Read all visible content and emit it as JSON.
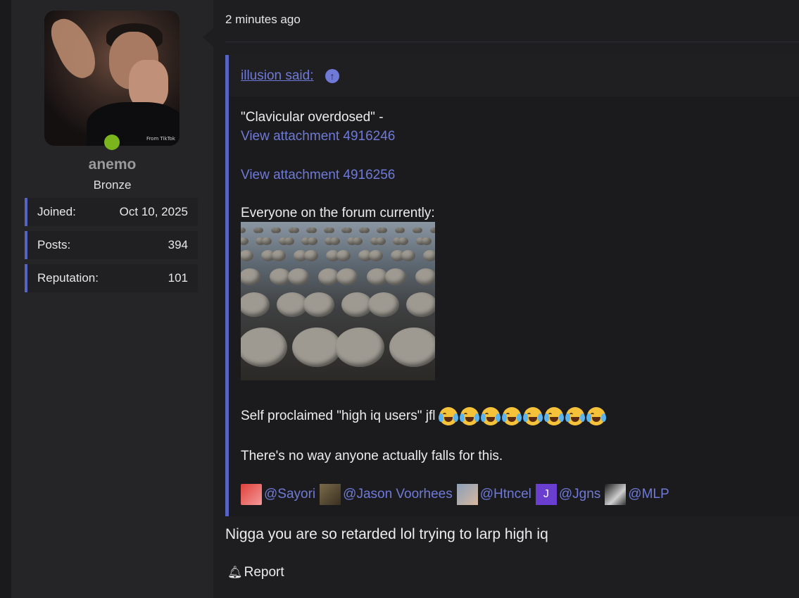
{
  "user": {
    "username": "anemo",
    "rank": "Bronze",
    "online": true,
    "avatar_watermark": "From TikTok",
    "stats": [
      {
        "label": "Joined:",
        "value": "Oct 10, 2025"
      },
      {
        "label": "Posts:",
        "value": "394"
      },
      {
        "label": "Reputation:",
        "value": "101"
      }
    ]
  },
  "post": {
    "time": "2 minutes ago",
    "quote": {
      "author_label": "illusion said:",
      "line1": "\"Clavicular overdosed\" -",
      "attachment1": "View attachment 4916246",
      "attachment2": "View attachment 4916256",
      "line2": "Everyone on the forum currently:",
      "line3": "Self proclaimed \"high iq users\" jfl",
      "emoji_name": "crying-laughing-emoji",
      "emoji_count": 8,
      "line4": "There's no way anyone actually falls for this.",
      "mentions": [
        "@Sayori",
        "@Jason Voorhees",
        "@Htncel",
        "@Jgns",
        "@MLP"
      ],
      "jgns_avatar_letter": "J"
    },
    "body": "Nigga you are so retarded lol trying to larp high iq",
    "report_label": "Report"
  },
  "colors": {
    "accent": "#5864c4",
    "link": "#6f7ad8",
    "online": "#7ab51d",
    "background": "#1e1e21",
    "sidebar": "#252528"
  }
}
